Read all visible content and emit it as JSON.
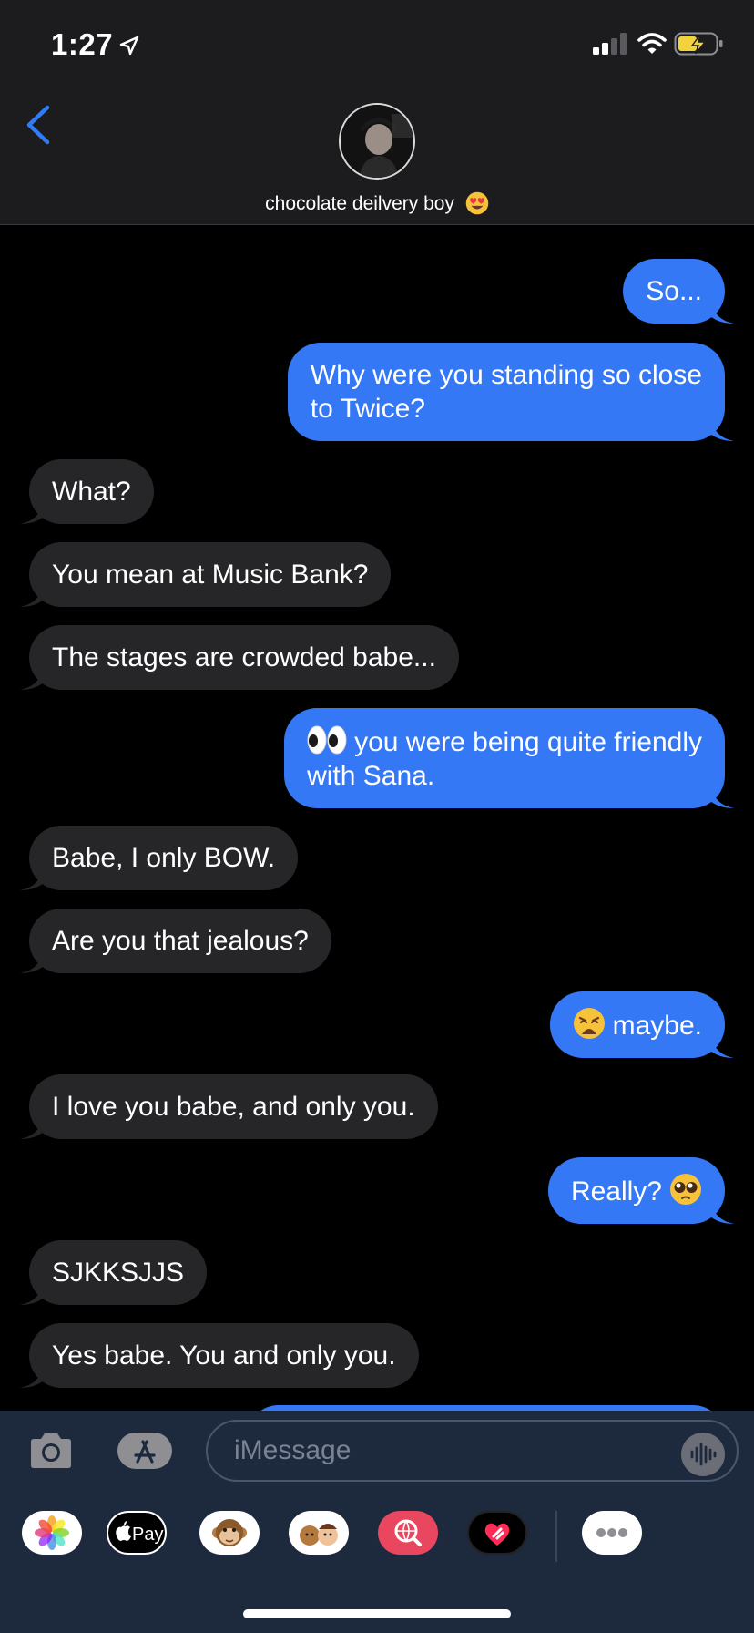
{
  "status_bar": {
    "time": "1:27",
    "location_icon": "location-arrow-icon",
    "signal_icon": "cellular-signal-icon",
    "wifi_icon": "wifi-icon",
    "battery_icon": "battery-charging-icon"
  },
  "header": {
    "back_icon": "chevron-left-icon",
    "contact_name": "chocolate deilvery boy",
    "contact_emoji": "heart-eyes-emoji"
  },
  "messages": [
    {
      "side": "sent",
      "text": "So..."
    },
    {
      "side": "sent",
      "lines": [
        "Why were you standing so close",
        "to Twice?"
      ]
    },
    {
      "side": "received",
      "text": "What?"
    },
    {
      "side": "received",
      "text": "You mean at Music Bank?"
    },
    {
      "side": "received",
      "text": "The stages are crowded babe..."
    },
    {
      "side": "sent",
      "emoji": "eyes-emoji",
      "lines": [
        "you were being quite friendly",
        "with Sana."
      ]
    },
    {
      "side": "received",
      "text": "Babe, I only BOW."
    },
    {
      "side": "received",
      "text": "Are you that jealous?"
    },
    {
      "side": "sent",
      "emoji": "weary-face-emoji",
      "text": "maybe."
    },
    {
      "side": "received",
      "text": "I love you babe, and only you."
    },
    {
      "side": "sent",
      "text": "Really?",
      "emoji_after": "pleading-face-emoji"
    },
    {
      "side": "received",
      "text": "SJKKSJJS"
    },
    {
      "side": "received",
      "text": "Yes babe. You and only you."
    }
  ],
  "input_bar": {
    "placeholder": "iMessage",
    "camera_icon": "camera-icon",
    "apps_icon": "app-store-icon",
    "audio_icon": "audio-waveform-icon"
  },
  "app_drawer": [
    {
      "name": "photos-app-icon"
    },
    {
      "name": "apple-pay-app-icon",
      "label": "Pay"
    },
    {
      "name": "animoji-app-icon"
    },
    {
      "name": "memoji-stickers-app-icon"
    },
    {
      "name": "images-search-app-icon"
    },
    {
      "name": "digital-touch-app-icon"
    },
    {
      "name": "more-apps-icon"
    }
  ],
  "colors": {
    "sent_bubble": "#3478f6",
    "received_bubble": "#262628",
    "chrome": "#1c1c1e",
    "input_bar": "#1d2a3e",
    "accent": "#2f7cf6"
  }
}
